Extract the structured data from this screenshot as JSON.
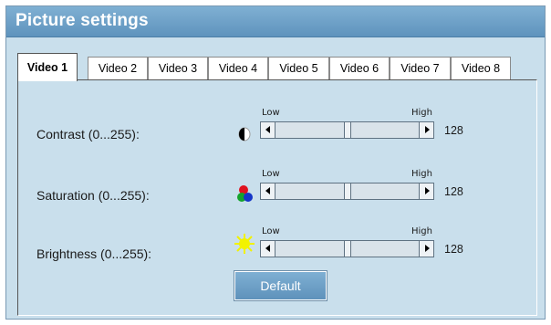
{
  "panel": {
    "title": "Picture settings"
  },
  "tabs": [
    {
      "label": "Video 1",
      "active": true
    },
    {
      "label": "Video 2",
      "active": false
    },
    {
      "label": "Video 3",
      "active": false
    },
    {
      "label": "Video 4",
      "active": false
    },
    {
      "label": "Video 5",
      "active": false
    },
    {
      "label": "Video 6",
      "active": false
    },
    {
      "label": "Video 7",
      "active": false
    },
    {
      "label": "Video 8",
      "active": false
    }
  ],
  "settings": {
    "contrast": {
      "label": "Contrast (0...255):",
      "low": "Low",
      "high": "High",
      "value": "128",
      "icon": "contrast-icon"
    },
    "saturation": {
      "label": "Saturation (0...255):",
      "low": "Low",
      "high": "High",
      "value": "128",
      "icon": "color-dots-icon"
    },
    "brightness": {
      "label": "Brightness (0...255):",
      "low": "Low",
      "high": "High",
      "value": "128",
      "icon": "sun-icon"
    }
  },
  "default_button": "Default",
  "colors": {
    "title_bar": "#6fa3c9",
    "panel_bg": "#c9dfec",
    "button": "#6fa3c9"
  }
}
